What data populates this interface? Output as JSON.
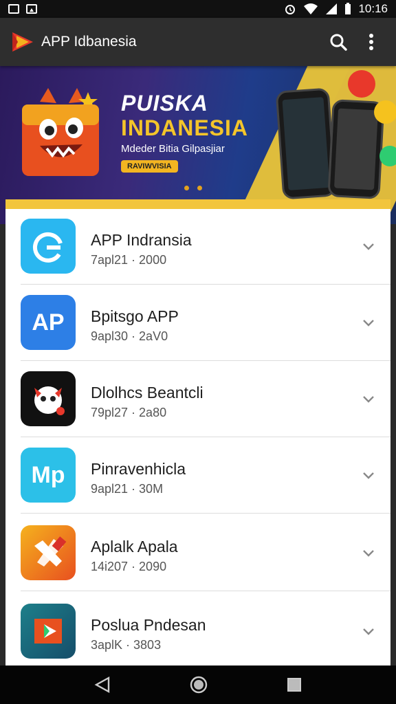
{
  "status_bar": {
    "time": "10:16"
  },
  "app_bar": {
    "title": "APP Idbanesia"
  },
  "banner": {
    "title_line1": "PUISKA",
    "title_line2": "INDANESIA",
    "subtitle": "Mdeder Bitia Gilpasjiar",
    "badge": "RAVIWVISIA"
  },
  "apps": [
    {
      "name": "APP Indransia",
      "meta": "7apl21 · 2000",
      "icon_text": "",
      "icon_color": "#2ab7f0"
    },
    {
      "name": "Bpitsgo APP",
      "meta": "9apl30 · 2aV0",
      "icon_text": "AP",
      "icon_color": "#2d7fe6"
    },
    {
      "name": "Dlolhcs Beantcli",
      "meta": "79pl27 · 2a80",
      "icon_text": "",
      "icon_color": "#111111"
    },
    {
      "name": "Pinravenhicla",
      "meta": "9apl21 · 30M",
      "icon_text": "Mp",
      "icon_color": "#2cc0e8"
    },
    {
      "name": "Aplalk Apala",
      "meta": "14i207 · 2090",
      "icon_text": "",
      "icon_color": "#f39a1a"
    },
    {
      "name": "Poslua Pndesan",
      "meta": "3aplK · 3803",
      "icon_text": "",
      "icon_color": "#1e7f8a"
    }
  ]
}
